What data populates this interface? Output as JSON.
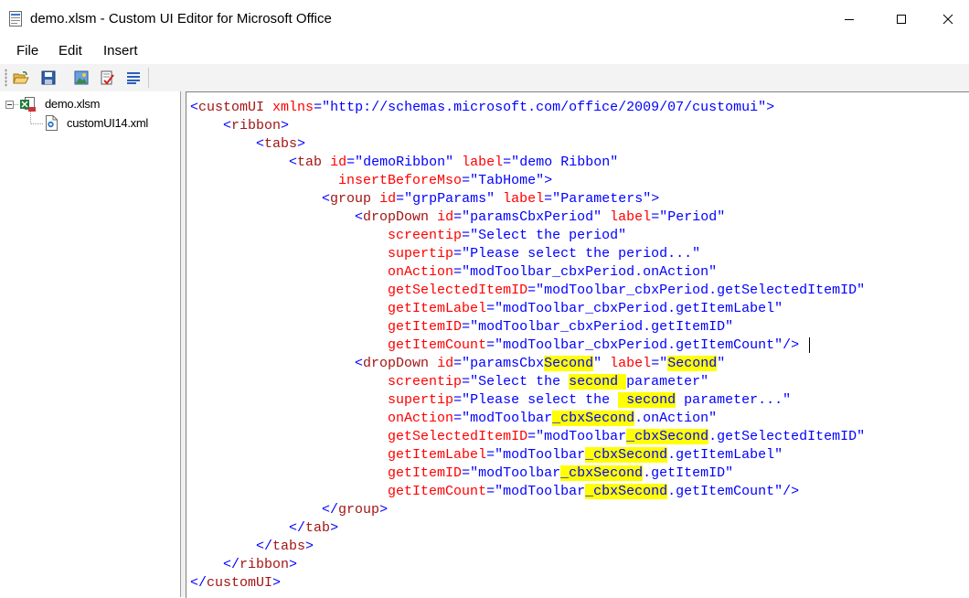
{
  "window": {
    "title": "demo.xlsm - Custom UI Editor for Microsoft Office"
  },
  "menu": [
    "File",
    "Edit",
    "Insert"
  ],
  "toolbar": {
    "buttons": [
      {
        "name": "open-icon"
      },
      {
        "name": "save-icon"
      },
      {
        "name": "insert-icons-icon"
      },
      {
        "name": "validate-icon"
      },
      {
        "name": "generate-callbacks-icon"
      }
    ]
  },
  "tree": {
    "root": "demo.xlsm",
    "children": [
      "customUI14.xml"
    ]
  },
  "editor": {
    "search_highlight": "Second",
    "lines": [
      [
        [
          "p",
          "<"
        ],
        [
          "t",
          "customUI"
        ],
        [
          "x",
          " "
        ],
        [
          "a",
          "xmlns"
        ],
        [
          "p",
          "=\""
        ],
        [
          "v",
          "http://schemas.microsoft.com/office/2009/07/customui"
        ],
        [
          "p",
          "\">"
        ]
      ],
      [
        [
          "x",
          "    "
        ],
        [
          "p",
          "<"
        ],
        [
          "t",
          "ribbon"
        ],
        [
          "p",
          ">"
        ]
      ],
      [
        [
          "x",
          "        "
        ],
        [
          "p",
          "<"
        ],
        [
          "t",
          "tabs"
        ],
        [
          "p",
          ">"
        ]
      ],
      [
        [
          "x",
          "            "
        ],
        [
          "p",
          "<"
        ],
        [
          "t",
          "tab"
        ],
        [
          "x",
          " "
        ],
        [
          "a",
          "id"
        ],
        [
          "p",
          "=\""
        ],
        [
          "v",
          "demoRibbon"
        ],
        [
          "p",
          "\""
        ],
        [
          "x",
          " "
        ],
        [
          "a",
          "label"
        ],
        [
          "p",
          "=\""
        ],
        [
          "v",
          "demo Ribbon"
        ],
        [
          "p",
          "\""
        ]
      ],
      [
        [
          "x",
          "                  "
        ],
        [
          "a",
          "insertBeforeMso"
        ],
        [
          "p",
          "=\""
        ],
        [
          "v",
          "TabHome"
        ],
        [
          "p",
          "\">"
        ]
      ],
      [
        [
          "x",
          "                "
        ],
        [
          "p",
          "<"
        ],
        [
          "t",
          "group"
        ],
        [
          "x",
          " "
        ],
        [
          "a",
          "id"
        ],
        [
          "p",
          "=\""
        ],
        [
          "v",
          "grpParams"
        ],
        [
          "p",
          "\""
        ],
        [
          "x",
          " "
        ],
        [
          "a",
          "label"
        ],
        [
          "p",
          "=\""
        ],
        [
          "v",
          "Parameters"
        ],
        [
          "p",
          "\">"
        ]
      ],
      [
        [
          "x",
          "                    "
        ],
        [
          "p",
          "<"
        ],
        [
          "t",
          "dropDown"
        ],
        [
          "x",
          " "
        ],
        [
          "a",
          "id"
        ],
        [
          "p",
          "=\""
        ],
        [
          "v",
          "paramsCbxPeriod"
        ],
        [
          "p",
          "\""
        ],
        [
          "x",
          " "
        ],
        [
          "a",
          "label"
        ],
        [
          "p",
          "=\""
        ],
        [
          "v",
          "Period"
        ],
        [
          "p",
          "\""
        ]
      ],
      [
        [
          "x",
          "                        "
        ],
        [
          "a",
          "screentip"
        ],
        [
          "p",
          "=\""
        ],
        [
          "v",
          "Select the period"
        ],
        [
          "p",
          "\""
        ]
      ],
      [
        [
          "x",
          "                        "
        ],
        [
          "a",
          "supertip"
        ],
        [
          "p",
          "=\""
        ],
        [
          "v",
          "Please select the period..."
        ],
        [
          "p",
          "\""
        ]
      ],
      [
        [
          "x",
          "                        "
        ],
        [
          "a",
          "onAction"
        ],
        [
          "p",
          "=\""
        ],
        [
          "v",
          "modToolbar_cbxPeriod.onAction"
        ],
        [
          "p",
          "\""
        ]
      ],
      [
        [
          "x",
          "                        "
        ],
        [
          "a",
          "getSelectedItemID"
        ],
        [
          "p",
          "=\""
        ],
        [
          "v",
          "modToolbar_cbxPeriod.getSelectedItemID"
        ],
        [
          "p",
          "\""
        ]
      ],
      [
        [
          "x",
          "                        "
        ],
        [
          "a",
          "getItemLabel"
        ],
        [
          "p",
          "=\""
        ],
        [
          "v",
          "modToolbar_cbxPeriod.getItemLabel"
        ],
        [
          "p",
          "\""
        ]
      ],
      [
        [
          "x",
          "                        "
        ],
        [
          "a",
          "getItemID"
        ],
        [
          "p",
          "=\""
        ],
        [
          "v",
          "modToolbar_cbxPeriod.getItemID"
        ],
        [
          "p",
          "\""
        ]
      ],
      [
        [
          "x",
          "                        "
        ],
        [
          "a",
          "getItemCount"
        ],
        [
          "p",
          "=\""
        ],
        [
          "v",
          "modToolbar_cbxPeriod.getItemCount"
        ],
        [
          "p",
          "\"/>"
        ],
        [
          "caret",
          ""
        ]
      ],
      [
        [
          "x",
          "                    "
        ],
        [
          "p",
          "<"
        ],
        [
          "t",
          "dropDown"
        ],
        [
          "x",
          " "
        ],
        [
          "a",
          "id"
        ],
        [
          "p",
          "=\""
        ],
        [
          "v",
          "paramsCbx"
        ],
        [
          "vh",
          "Second"
        ],
        [
          "p",
          "\""
        ],
        [
          "x",
          " "
        ],
        [
          "a",
          "label"
        ],
        [
          "p",
          "=\""
        ],
        [
          "vh",
          "Second"
        ],
        [
          "p",
          "\""
        ]
      ],
      [
        [
          "x",
          "                        "
        ],
        [
          "a",
          "screentip"
        ],
        [
          "p",
          "=\""
        ],
        [
          "v",
          "Select the "
        ],
        [
          "vh",
          "second "
        ],
        [
          "v",
          "parameter"
        ],
        [
          "p",
          "\""
        ]
      ],
      [
        [
          "x",
          "                        "
        ],
        [
          "a",
          "supertip"
        ],
        [
          "p",
          "=\""
        ],
        [
          "v",
          "Please select the "
        ],
        [
          "vh",
          " second"
        ],
        [
          "v",
          " parameter..."
        ],
        [
          "p",
          "\""
        ]
      ],
      [
        [
          "x",
          "                        "
        ],
        [
          "a",
          "onAction"
        ],
        [
          "p",
          "=\""
        ],
        [
          "v",
          "modToolbar"
        ],
        [
          "vh",
          "_cbxSecond"
        ],
        [
          "v",
          ".onAction"
        ],
        [
          "p",
          "\""
        ]
      ],
      [
        [
          "x",
          "                        "
        ],
        [
          "a",
          "getSelectedItemID"
        ],
        [
          "p",
          "=\""
        ],
        [
          "v",
          "modToolbar"
        ],
        [
          "vh",
          "_cbxSecond"
        ],
        [
          "v",
          ".getSelectedItemID"
        ],
        [
          "p",
          "\""
        ]
      ],
      [
        [
          "x",
          "                        "
        ],
        [
          "a",
          "getItemLabel"
        ],
        [
          "p",
          "=\""
        ],
        [
          "v",
          "modToolbar"
        ],
        [
          "vh",
          "_cbxSecond"
        ],
        [
          "v",
          ".getItemLabel"
        ],
        [
          "p",
          "\""
        ]
      ],
      [
        [
          "x",
          "                        "
        ],
        [
          "a",
          "getItemID"
        ],
        [
          "p",
          "=\""
        ],
        [
          "v",
          "modToolbar"
        ],
        [
          "vh",
          "_cbxSecond"
        ],
        [
          "v",
          ".getItemID"
        ],
        [
          "p",
          "\""
        ]
      ],
      [
        [
          "x",
          "                        "
        ],
        [
          "a",
          "getItemCount"
        ],
        [
          "p",
          "=\""
        ],
        [
          "v",
          "modToolbar"
        ],
        [
          "vh",
          "_cbxSecond"
        ],
        [
          "v",
          ".getItemCount"
        ],
        [
          "p",
          "\"/>"
        ]
      ],
      [
        [
          "x",
          "                "
        ],
        [
          "p",
          "</"
        ],
        [
          "t",
          "group"
        ],
        [
          "p",
          ">"
        ]
      ],
      [
        [
          "x",
          "            "
        ],
        [
          "p",
          "</"
        ],
        [
          "t",
          "tab"
        ],
        [
          "p",
          ">"
        ]
      ],
      [
        [
          "x",
          "        "
        ],
        [
          "p",
          "</"
        ],
        [
          "t",
          "tabs"
        ],
        [
          "p",
          ">"
        ]
      ],
      [
        [
          "x",
          "    "
        ],
        [
          "p",
          "</"
        ],
        [
          "t",
          "ribbon"
        ],
        [
          "p",
          ">"
        ]
      ],
      [
        [
          "p",
          "</"
        ],
        [
          "t",
          "customUI"
        ],
        [
          "p",
          ">"
        ]
      ]
    ]
  }
}
